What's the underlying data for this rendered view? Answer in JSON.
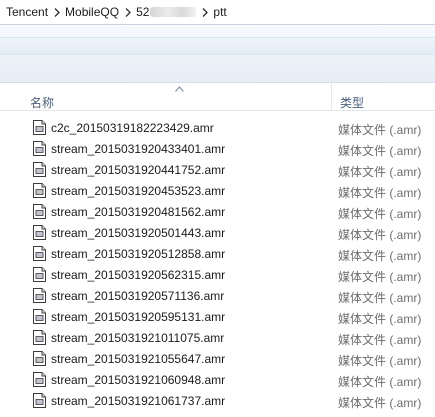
{
  "breadcrumb": {
    "items": [
      "Tencent",
      "MobileQQ",
      "52",
      "ptt"
    ]
  },
  "columns": {
    "name_label": "名称",
    "type_label": "类型"
  },
  "files": [
    {
      "name": "c2c_20150319182223429.amr",
      "type": "媒体文件 (.amr)"
    },
    {
      "name": "stream_20150319204334 01.amr",
      "type": "媒体文件 (.amr)"
    },
    {
      "name": "stream_20150319204417 52.amr",
      "type": "媒体文件 (.amr)"
    },
    {
      "name": "stream_20150319204535 23.amr",
      "type": "媒体文件 (.amr)"
    },
    {
      "name": "stream_20150319204815 62.amr",
      "type": "媒体文件 (.amr)"
    },
    {
      "name": "stream_20150319205014 43.amr",
      "type": "媒体文件 (.amr)"
    },
    {
      "name": "stream_20150319205128 58.amr",
      "type": "媒体文件 (.amr)"
    },
    {
      "name": "stream_20150319205623 15.amr",
      "type": "媒体文件 (.amr)"
    },
    {
      "name": "stream_20150319205711 36.amr",
      "type": "媒体文件 (.amr)"
    },
    {
      "name": "stream_20150319205951 31.amr",
      "type": "媒体文件 (.amr)"
    },
    {
      "name": "stream_20150319210110 75.amr",
      "type": "媒体文件 (.amr)"
    },
    {
      "name": "stream_20150319210556 47.amr",
      "type": "媒体文件 (.amr)"
    },
    {
      "name": "stream_20150319210609 48.amr",
      "type": "媒体文件 (.amr)"
    },
    {
      "name": "stream_20150319210617 37.amr",
      "type": "媒体文件 (.amr)"
    }
  ],
  "icons": {
    "file": "media-file-icon",
    "separator": "chevron-right-icon",
    "sort": "sort-ascending-icon"
  }
}
